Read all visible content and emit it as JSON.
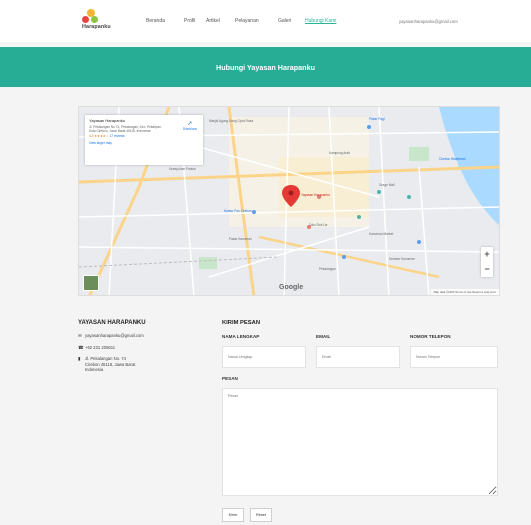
{
  "brand": {
    "name": "Harapanku",
    "tagline": "YAYASAN"
  },
  "nav": {
    "items": [
      "Beranda",
      "Profil",
      "Artikel",
      "Pelayanan",
      "Galeri",
      "Hubungi Kami"
    ],
    "active": "Hubungi Kami",
    "email": "yayasanharapanku@gmail.com"
  },
  "banner": {
    "title": "Hubungi Yayasan Harapanku"
  },
  "map": {
    "place_name": "Yayasan Harapanku",
    "place_address": "Jl. Pekalangan No.74, Pekalangan, Kec. Pekalipan, Kota Cirebon, Jawa Barat 45118, Indonesia",
    "rating": "4.3 ★★★★☆",
    "reviews": "17 reviews",
    "view_larger": "View larger map",
    "directions": "Directions",
    "pin_label": "Yayasan Harapanku",
    "labels": {
      "l1": "Masjid Agung Sang Cipta Rasa",
      "l2": "Kantor Pos Cirebon",
      "l3": "Kampung Arab",
      "l4": "Pasar Kanoman",
      "l5": "Cirebon Waterland",
      "l6": "Kesepuhan Palace",
      "l7": "Toko Roti Lie",
      "l8": "Pekalangan",
      "l9": "Kanoman Market",
      "l10": "Grage Mall",
      "l11": "Keraton Kanoman",
      "l12": "Pasar Pagi"
    },
    "zoom_in": "+",
    "zoom_out": "−",
    "footer": "Map data ©2020   Terms of Use   Report a map error",
    "google": "Google"
  },
  "contact": {
    "title": "YAYASAN HARAPANKU",
    "email": "yayasanharapanku@gmail.com",
    "phone": "+62 231 205611",
    "address_line1": "Jl. Pekalangan No. 74",
    "address_line2": "Cirebon 45118, Jawa Barat",
    "address_line3": "Indonesia",
    "icons": {
      "email": "envelope-icon",
      "phone": "phone-icon",
      "address": "building-icon"
    }
  },
  "form": {
    "title": "KIRIM PESAN",
    "name_label": "NAMA LENGKAP",
    "name_placeholder": "Nama Lengkap",
    "email_label": "EMAIL",
    "email_placeholder": "Email",
    "phone_label": "NOMOR TELEPON",
    "phone_placeholder": "Nomor Telepon",
    "message_label": "PESAN",
    "message_placeholder": "Pesan",
    "submit": "Kirim",
    "reset": "Reset"
  },
  "colors": {
    "accent": "#27ad96",
    "background": "#f4f4f4",
    "pin": "#e53935"
  }
}
